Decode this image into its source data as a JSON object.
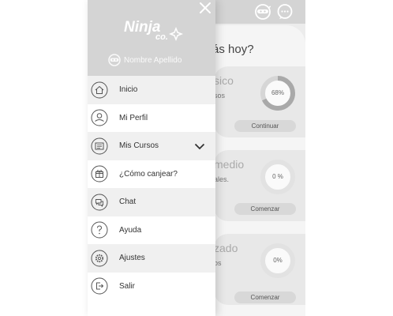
{
  "app": {
    "greeting": "ás hoy?",
    "courses": [
      {
        "title": "sico",
        "subtitle": "sos",
        "progress_label": "68%",
        "progress": 0.68,
        "button": "Continuar"
      },
      {
        "title": "medio",
        "subtitle": "ales.",
        "progress_label": "0 %",
        "progress": 0,
        "button": "Comenzar"
      },
      {
        "title": "zado",
        "subtitle": "os",
        "progress_label": "0%",
        "progress": 0,
        "button": "Comenzar"
      }
    ]
  },
  "drawer": {
    "logo_text": "Ninja",
    "logo_suffix": "co.",
    "user_name": "Nombre Apellido",
    "menu": [
      {
        "label": "Inicio",
        "icon": "home-icon"
      },
      {
        "label": "Mi Perfil",
        "icon": "profile-icon"
      },
      {
        "label": "Mis Cursos",
        "icon": "courses-icon",
        "expandable": true
      },
      {
        "label": "¿Cómo canjear?",
        "icon": "gift-icon"
      },
      {
        "label": "Chat",
        "icon": "chat-icon"
      },
      {
        "label": "Ayuda",
        "icon": "help-icon"
      },
      {
        "label": "Ajustes",
        "icon": "settings-icon"
      },
      {
        "label": "Salir",
        "icon": "logout-icon"
      }
    ]
  },
  "colors": {
    "header_gray": "#d4d4d4",
    "row_alt": "#f0f0f0",
    "icon_stroke": "#555555"
  }
}
